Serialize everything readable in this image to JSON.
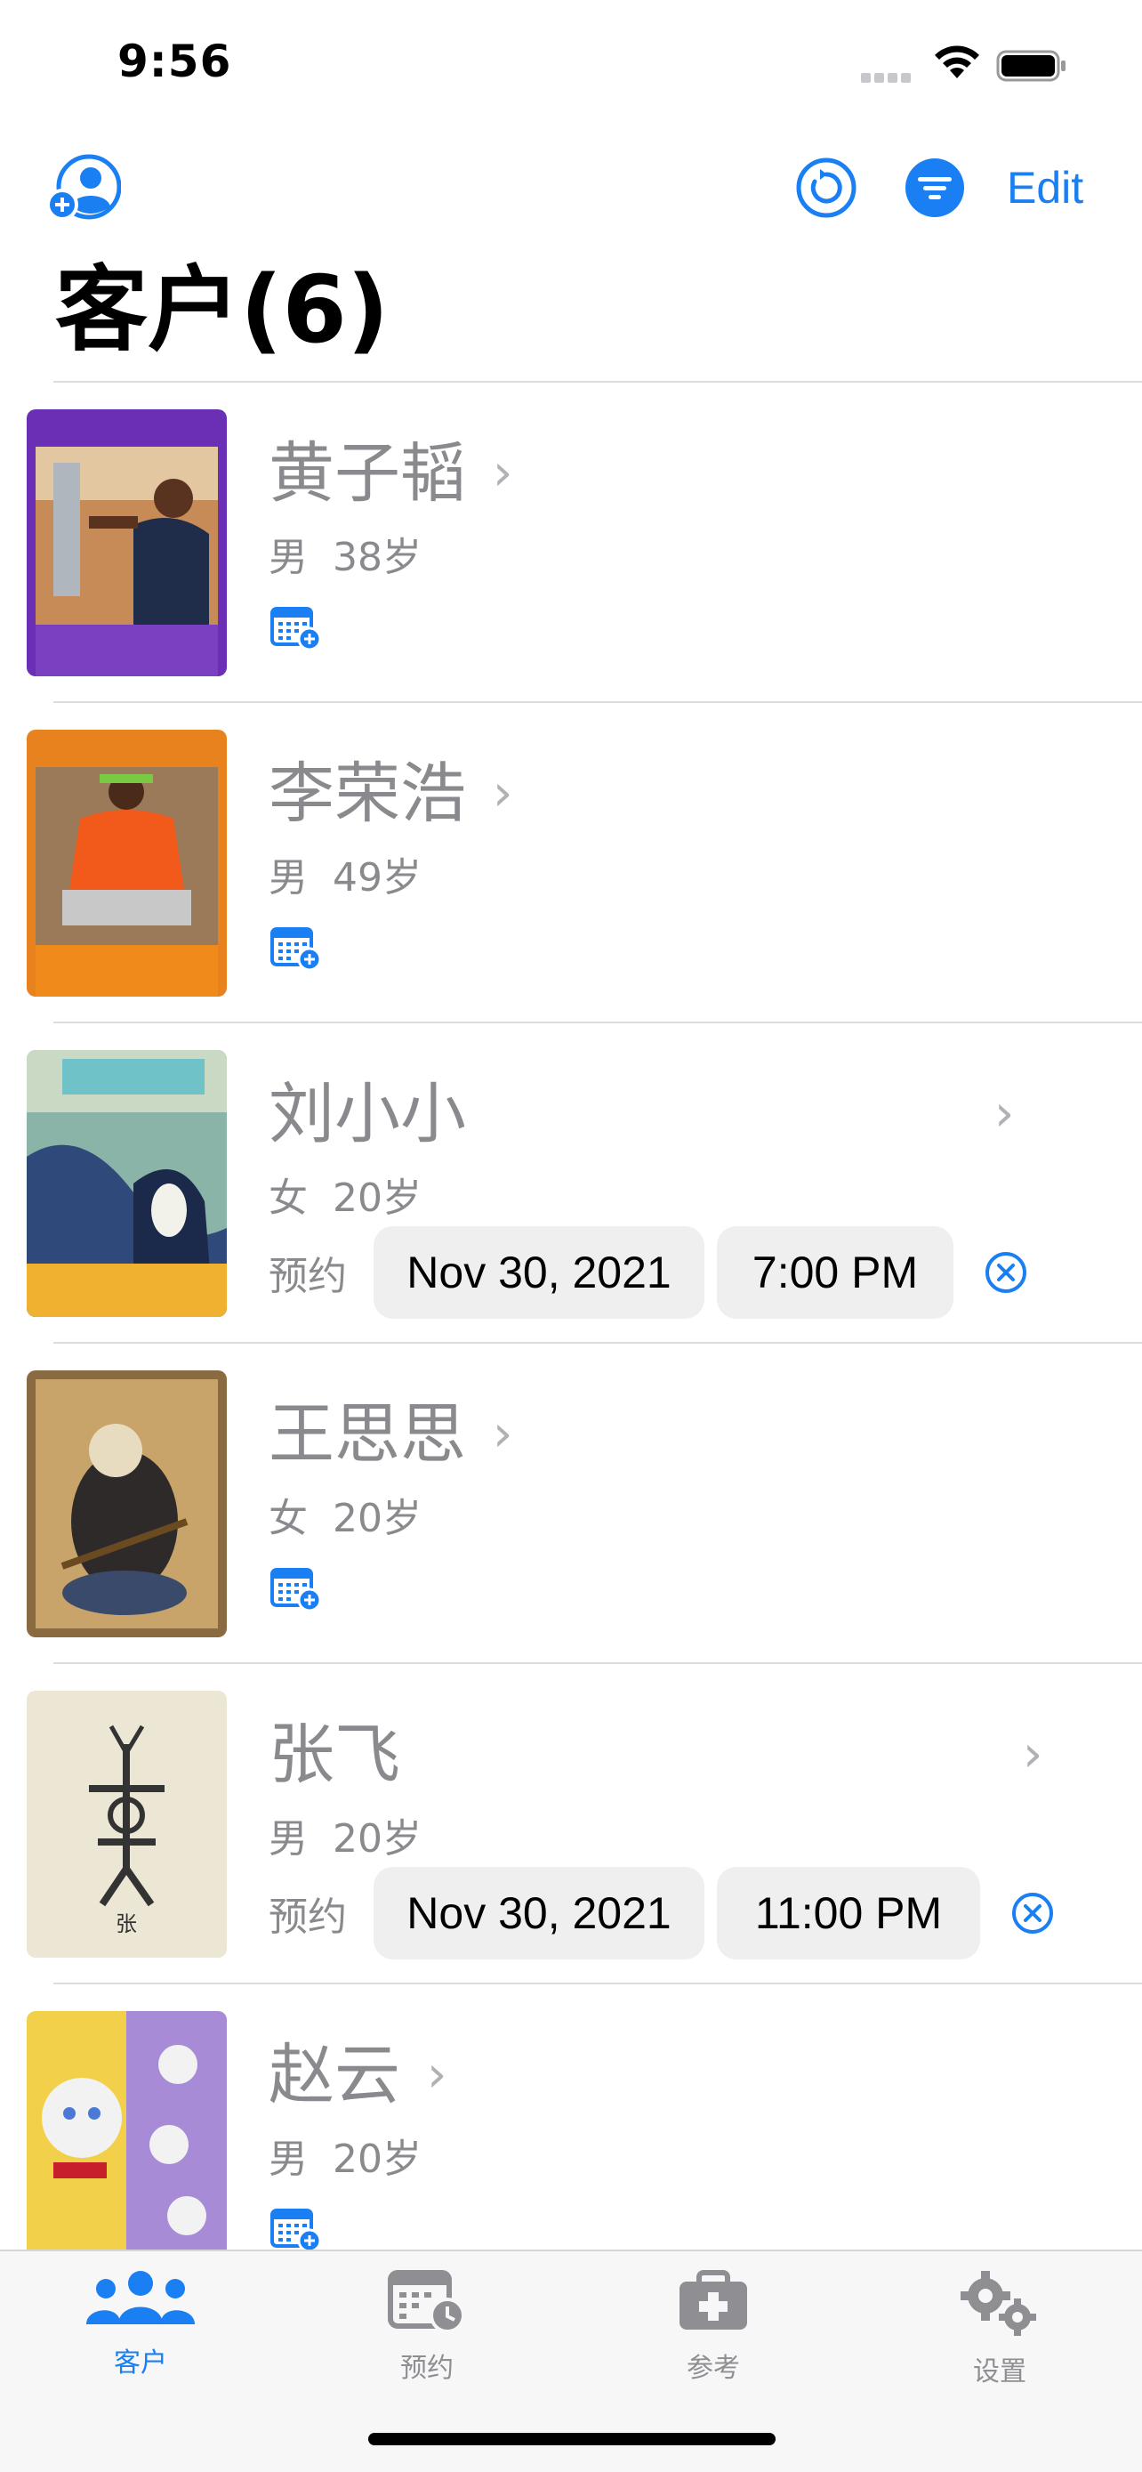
{
  "status_bar": {
    "time": "9:56"
  },
  "nav": {
    "edit_label": "Edit"
  },
  "page": {
    "title": "客户(6)"
  },
  "customers": [
    {
      "name": "黄子韬",
      "gender": "男",
      "age": "38岁",
      "has_appointment": false,
      "photo": {
        "type": "poster",
        "bg": "#6a2fb5",
        "accent": "#d98a3a"
      }
    },
    {
      "name": "李荣浩",
      "gender": "男",
      "age": "49岁",
      "has_appointment": false,
      "photo": {
        "type": "poster",
        "bg": "#e8821e",
        "accent": "#f25a1c"
      }
    },
    {
      "name": "刘小小",
      "gender": "女",
      "age": "20岁",
      "has_appointment": true,
      "appointment_label": "预约",
      "appointment_date": "Nov 30, 2021",
      "appointment_time": "7:00 PM",
      "photo": {
        "type": "mural",
        "bg": "#8ab4a8",
        "accent": "#f0b030"
      }
    },
    {
      "name": "王思思",
      "gender": "女",
      "age": "20岁",
      "has_appointment": false,
      "photo": {
        "type": "cat-painting",
        "bg": "#c9a46a",
        "accent": "#3a3a3a"
      }
    },
    {
      "name": "张飞",
      "gender": "男",
      "age": "20岁",
      "has_appointment": true,
      "appointment_label": "预约",
      "appointment_date": "Nov 30, 2021",
      "appointment_time": "11:00 PM",
      "photo": {
        "type": "glyph",
        "bg": "#ece6d4",
        "accent": "#333333",
        "caption": "张"
      }
    },
    {
      "name": "赵云",
      "gender": "男",
      "age": "20岁",
      "has_appointment": false,
      "photo": {
        "type": "cat-socks",
        "bg": "#a78bd6",
        "accent": "#f2f2f2"
      }
    }
  ],
  "tabs": [
    {
      "label": "客户",
      "icon": "people-icon",
      "active": true
    },
    {
      "label": "预约",
      "icon": "calendar-clock-icon",
      "active": false
    },
    {
      "label": "参考",
      "icon": "medical-kit-icon",
      "active": false
    },
    {
      "label": "设置",
      "icon": "gears-icon",
      "active": false
    }
  ],
  "colors": {
    "accent": "#1a7ff2",
    "secondary_text": "#8a8a8e",
    "pill_bg": "#efeff0"
  }
}
